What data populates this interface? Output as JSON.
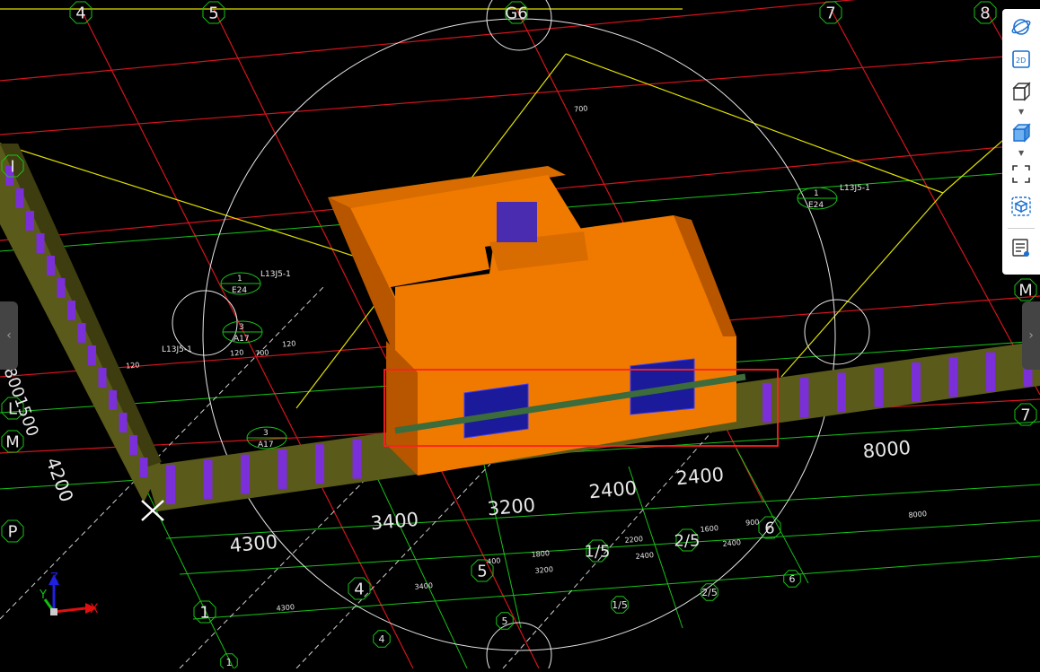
{
  "axes": {
    "top": [
      "4",
      "5",
      "G6",
      "7",
      "8"
    ],
    "left": [
      "I",
      "L",
      "M",
      "P"
    ],
    "right": [
      "M",
      "7"
    ],
    "bottom": [
      "1",
      "4",
      "5",
      "6",
      "1/5",
      "2/5"
    ],
    "bottom_small": [
      "1",
      "4",
      "5",
      "1/5",
      "2/5",
      "6"
    ]
  },
  "dimensions": {
    "bottom_row": [
      "4300",
      "3400",
      "3200",
      "2400",
      "2400",
      "8000"
    ],
    "small_row": [
      "400",
      "1800",
      "2200",
      "1600",
      "900",
      "3200",
      "2400",
      "2400",
      "8000"
    ],
    "left": [
      "4200",
      "8001500"
    ],
    "small_left": [
      "4300",
      "3400",
      "700",
      "120",
      "120",
      "700",
      "120"
    ]
  },
  "tags": {
    "top_right": {
      "id": "1",
      "code": "E24",
      "label": "L13J5-1"
    },
    "left_a": {
      "id": "1",
      "code": "E24",
      "label": "L13J5-1"
    },
    "left_b": {
      "id": "3",
      "code": "A17"
    },
    "left_c": {
      "id": "3",
      "code": "A17"
    },
    "left_d": {
      "label": "L13J5-1"
    }
  },
  "axis_indicator": {
    "x": "X",
    "y": "Y",
    "z": "Z"
  },
  "toolbar": {
    "items": [
      "orbit-icon",
      "2d-view-icon",
      "3d-box-icon",
      "solid-view-icon",
      "fit-view-icon",
      "section-box-icon",
      "properties-icon"
    ],
    "2d_label": "2D"
  },
  "side_tabs": {
    "left": "‹",
    "right": "›"
  },
  "colors": {
    "building": "#f07a00",
    "building_shade": "#b85600",
    "wall_purple": "#7a2fd8",
    "wall_olive": "#5a5a1a",
    "grid_red": "#d4141e",
    "grid_green": "#18c418",
    "line_yellow": "#e0e000",
    "selection": "#ff2020",
    "window": "#1a1a9a"
  }
}
